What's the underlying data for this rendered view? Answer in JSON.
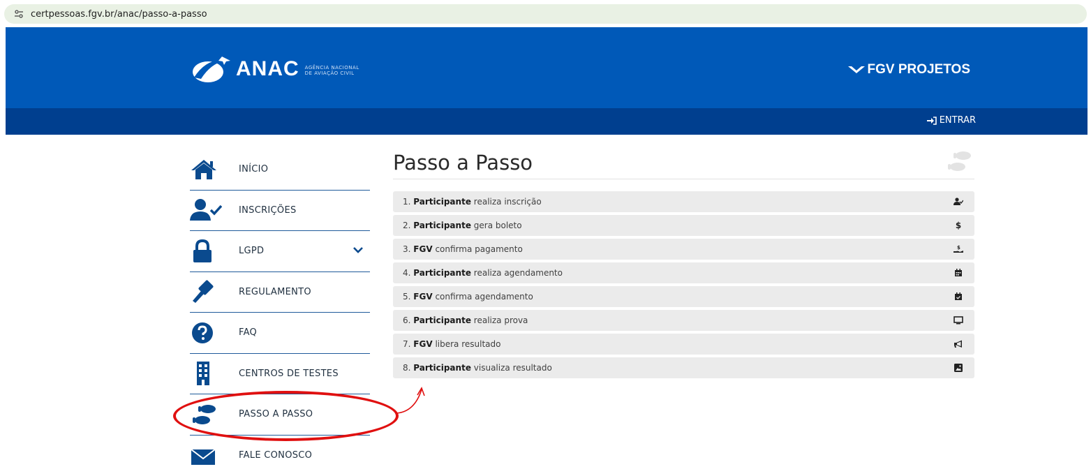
{
  "browser": {
    "url": "certpessoas.fgv.br/anac/passo-a-passo"
  },
  "header": {
    "anac_wordmark": "ANAC",
    "anac_subtitle_line1": "AGÊNCIA NACIONAL",
    "anac_subtitle_line2": "DE AVIAÇÃO CIVIL",
    "fgv_wordmark": "FGV PROJETOS",
    "brand_color": "#0059b8",
    "nav_color": "#003f8f"
  },
  "navbar": {
    "login_label": "ENTRAR"
  },
  "sidebar": {
    "items": [
      {
        "label": "INÍCIO",
        "icon": "home-icon"
      },
      {
        "label": "INSCRIÇÕES",
        "icon": "user-check-icon"
      },
      {
        "label": "LGPD",
        "icon": "lock-icon"
      },
      {
        "label": "REGULAMENTO",
        "icon": "gavel-icon"
      },
      {
        "label": "FAQ",
        "icon": "question-circle-icon"
      },
      {
        "label": "CENTROS DE TESTES",
        "icon": "building-icon"
      },
      {
        "label": "PASSO A PASSO",
        "icon": "footprints-icon"
      },
      {
        "label": "FALE CONOSCO",
        "icon": "envelope-icon"
      }
    ]
  },
  "main": {
    "title": "Passo a Passo",
    "steps": [
      {
        "num": "1.",
        "actor": "Participante",
        "text": "realiza inscrição",
        "icon": "user-check-icon"
      },
      {
        "num": "2.",
        "actor": "Participante",
        "text": "gera boleto",
        "icon": "dollar-icon"
      },
      {
        "num": "3.",
        "actor": "FGV",
        "text": "confirma pagamento",
        "icon": "hand-coin-icon"
      },
      {
        "num": "4.",
        "actor": "Participante",
        "text": "realiza agendamento",
        "icon": "calendar-icon"
      },
      {
        "num": "5.",
        "actor": "FGV",
        "text": "confirma agendamento",
        "icon": "calendar-check-icon"
      },
      {
        "num": "6.",
        "actor": "Participante",
        "text": "realiza prova",
        "icon": "monitor-icon"
      },
      {
        "num": "7.",
        "actor": "FGV",
        "text": "libera resultado",
        "icon": "megaphone-icon"
      },
      {
        "num": "8.",
        "actor": "Participante",
        "text": "visualiza resultado",
        "icon": "image-icon"
      }
    ]
  },
  "annotation": {
    "color": "#e01010"
  }
}
